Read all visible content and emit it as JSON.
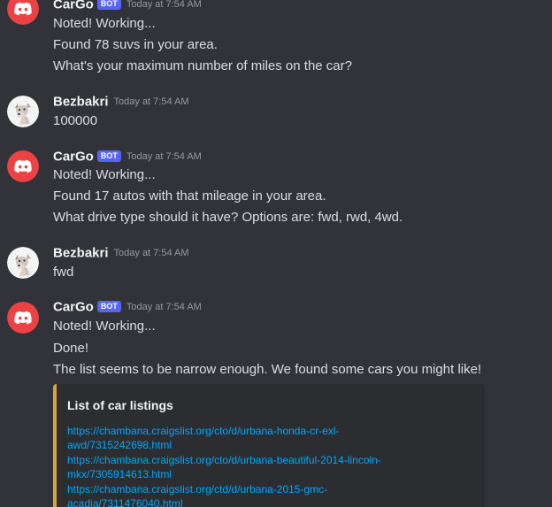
{
  "messages": [
    {
      "author": "CarGo",
      "bot_tag": "BOT",
      "timestamp": "Today at 7:54 AM",
      "avatar": "discord-logo-icon",
      "lines": [
        "Noted! Working...",
        "Found 78 suvs in your area.",
        "What's your maximum number of miles on the car?"
      ]
    },
    {
      "author": "Bezbakri",
      "timestamp": "Today at 7:54 AM",
      "avatar": "dog-avatar-icon",
      "lines": [
        "100000"
      ]
    },
    {
      "author": "CarGo",
      "bot_tag": "BOT",
      "timestamp": "Today at 7:54 AM",
      "avatar": "discord-logo-icon",
      "lines": [
        "Noted! Working...",
        "Found 17 autos with that mileage in your area.",
        "What drive type should it have? Options are: fwd, rwd, 4wd."
      ]
    },
    {
      "author": "Bezbakri",
      "timestamp": "Today at 7:54 AM",
      "avatar": "dog-avatar-icon",
      "lines": [
        "fwd"
      ]
    },
    {
      "author": "CarGo",
      "bot_tag": "BOT",
      "timestamp": "Today at 7:54 AM",
      "avatar": "discord-logo-icon",
      "lines": [
        "Noted! Working...",
        "Done!",
        "The list seems to be narrow enough. We found some cars you might like!"
      ]
    }
  ],
  "embed": {
    "title": "List of car listings",
    "accent_color": "#dca341",
    "link_lines": [
      "https://chambana.craigslist.org/cto/d/urbana-honda-cr-exl-",
      "awd/7315242698.html",
      "https://chambana.craigslist.org/cto/d/urbana-beautiful-2014-lincoln-",
      "mkx/7305914613.html",
      "https://chambana.craigslist.org/ctd/d/urbana-2015-gmc-",
      "acadia/7311476040.html"
    ]
  },
  "colors": {
    "background": "#313338",
    "bot_avatar": "#ed4245",
    "bot_tag": "#5865f2",
    "link": "#00a8fc"
  }
}
